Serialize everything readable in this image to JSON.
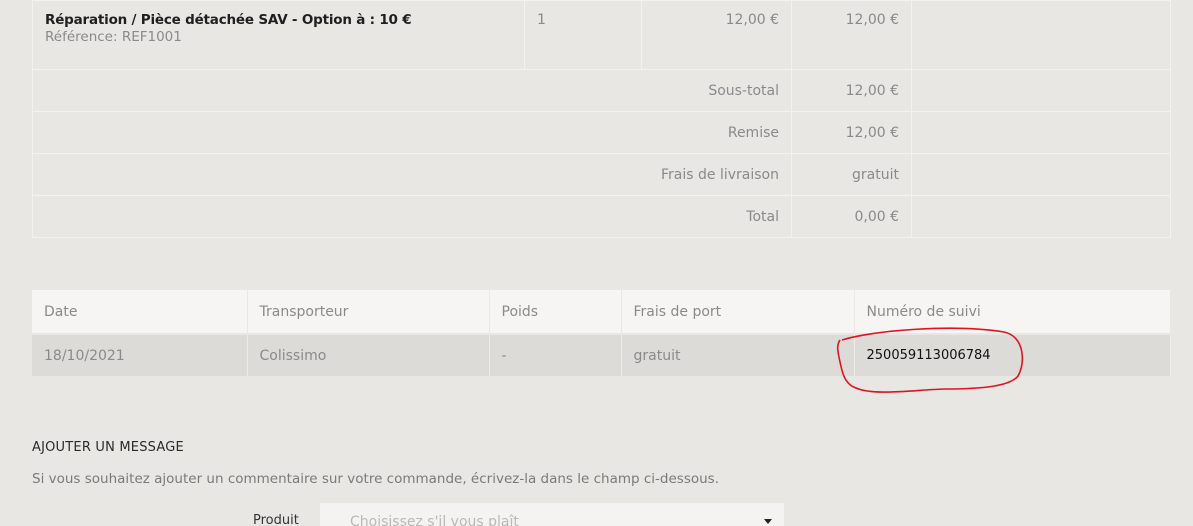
{
  "order": {
    "product": {
      "name": "Réparation / Pièce détachée SAV - Option à : 10 €",
      "reference": "Référence: REF1001",
      "quantity": "1",
      "unit_price": "12,00 €",
      "total_price": "12,00 €"
    },
    "summary": [
      {
        "label": "Sous-total",
        "value": "12,00 €"
      },
      {
        "label": "Remise",
        "value": "12,00 €"
      },
      {
        "label": "Frais de livraison",
        "value": "gratuit"
      },
      {
        "label": "Total",
        "value": "0,00 €"
      }
    ]
  },
  "shipping": {
    "headers": [
      "Date",
      "Transporteur",
      "Poids",
      "Frais de port",
      "Numéro de suivi"
    ],
    "row": {
      "date": "18/10/2021",
      "carrier": "Colissimo",
      "weight": "-",
      "shipping_cost": "gratuit",
      "tracking_number": "250059113006784"
    },
    "annotation_color": "#e0141e"
  },
  "message": {
    "title": "AJOUTER UN MESSAGE",
    "help": "Si vous souhaitez ajouter un commentaire sur votre commande, écrivez-la dans le champ ci-dessous.",
    "product_label": "Produit",
    "select_placeholder": "Choisissez s'il vous plaît"
  }
}
